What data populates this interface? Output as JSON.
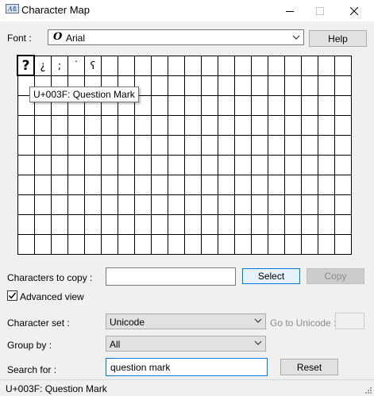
{
  "window": {
    "title": "Character Map",
    "icon": "character-map-app-icon"
  },
  "font": {
    "label": "Font :",
    "value": "Arial",
    "icon": "opentype-font-icon",
    "help_label": "Help"
  },
  "grid": {
    "rows": 10,
    "cols": 20,
    "characters": [
      "?",
      "¿",
      ";",
      "˙",
      "ʕ"
    ],
    "selected_index": 0,
    "tooltip": "U+003F: Question Mark"
  },
  "copy": {
    "label": "Characters to copy :",
    "value": "",
    "select_label": "Select",
    "copy_label": "Copy"
  },
  "advanced": {
    "label": "Advanced view",
    "checked": true
  },
  "charset": {
    "label": "Character set :",
    "value": "Unicode",
    "goto_label": "Go to Unicode :"
  },
  "groupby": {
    "label": "Group by :",
    "value": "All"
  },
  "search": {
    "label": "Search for :",
    "value": "question mark",
    "reset_label": "Reset"
  },
  "status": {
    "text": "U+003F: Question Mark"
  },
  "colors": {
    "accent": "#0078d7",
    "window_bg": "#f0f0f0",
    "button_bg": "#e1e1e1"
  }
}
